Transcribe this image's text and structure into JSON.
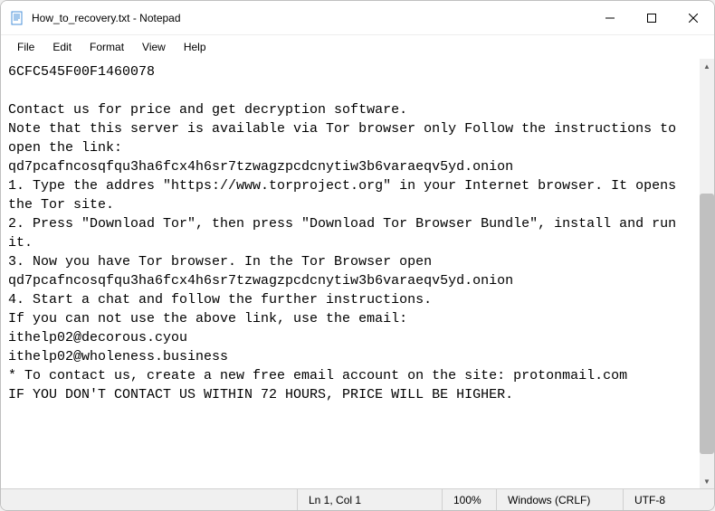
{
  "titlebar": {
    "title": "How_to_recovery.txt - Notepad"
  },
  "menubar": {
    "file": "File",
    "edit": "Edit",
    "format": "Format",
    "view": "View",
    "help": "Help"
  },
  "content": {
    "text": "6CFC545F00F1460078\n\nContact us for price and get decryption software.\nNote that this server is available via Tor browser only Follow the instructions to open the link:\nqd7pcafncosqfqu3ha6fcx4h6sr7tzwagzpcdcnytiw3b6varaeqv5yd.onion\n1. Type the addres \"https://www.torproject.org\" in your Internet browser. It opens the Tor site.\n2. Press \"Download Tor\", then press \"Download Tor Browser Bundle\", install and run it.\n3. Now you have Tor browser. In the Tor Browser open qd7pcafncosqfqu3ha6fcx4h6sr7tzwagzpcdcnytiw3b6varaeqv5yd.onion\n4. Start a chat and follow the further instructions.\nIf you can not use the above link, use the email:\nithelp02@decorous.cyou\nithelp02@wholeness.business\n* To contact us, create a new free email account on the site: protonmail.com\nIF YOU DON'T CONTACT US WITHIN 72 HOURS, PRICE WILL BE HIGHER."
  },
  "statusbar": {
    "position": "Ln 1, Col 1",
    "zoom": "100%",
    "line_ending": "Windows (CRLF)",
    "encoding": "UTF-8"
  },
  "scrollbar": {
    "thumb_top_percent": 30,
    "thumb_height_percent": 65
  }
}
